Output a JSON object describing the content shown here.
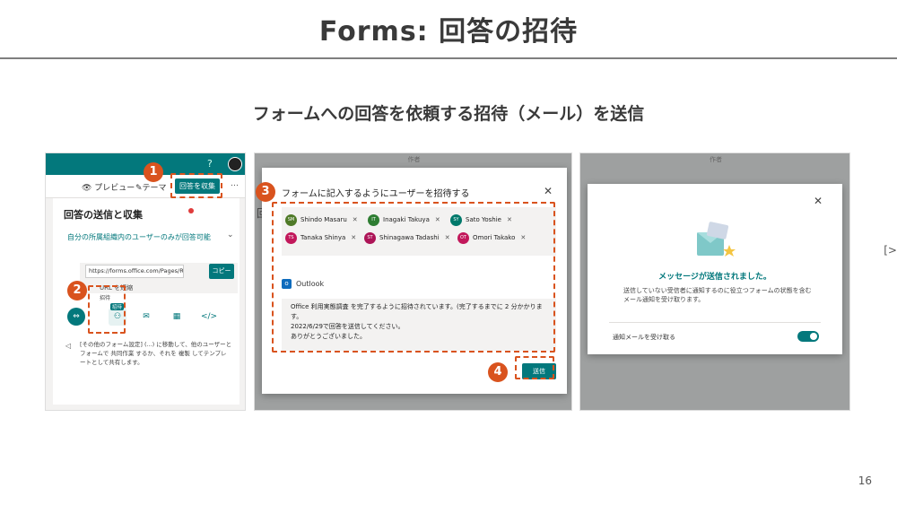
{
  "slide": {
    "title": "Forms: 回答の招待",
    "subtitle": "フォームへの回答を依頼する招待（メール）を送信",
    "page_number": "16",
    "edge_mark": "[>"
  },
  "callouts": [
    "1",
    "2",
    "3",
    "4"
  ],
  "shot1": {
    "help": "?",
    "preview": "👁 プレビュー",
    "theme": "✎テーマ",
    "collect_button": "回答を収集",
    "more": "…",
    "panel_title": "回答の送信と収集",
    "permission": "自分の所属組織内のユーザーのみが回答可能",
    "url": "https://forms.office.com/Pages/Resp...",
    "copy_button": "コピー",
    "short_url": "URL を短縮",
    "icon_label": "招待",
    "invite_badge": "招待",
    "bottom_text": "[その他のフォーム設定] (...) に移動して、他のユーザーとフォームで 共同作業 するか、それを 複製 してテンプレートとして共有します。"
  },
  "shot2": {
    "header": "作者",
    "edge_left": "回",
    "edge_right": "[",
    "title": "フォームに記入するようにユーザーを招待する",
    "close": "✕",
    "people": [
      {
        "initials": "SM",
        "name": "Shindo Masaru",
        "color": "#4f7a28"
      },
      {
        "initials": "IT",
        "name": "Inagaki Takuya",
        "color": "#2e7d32"
      },
      {
        "initials": "SY",
        "name": "Sato Yoshie",
        "color": "#00796b"
      },
      {
        "initials": "TS",
        "name": "Tanaka Shinya",
        "color": "#c2185b"
      },
      {
        "initials": "ST",
        "name": "Shinagawa Tadashi",
        "color": "#ad1457"
      },
      {
        "initials": "OT",
        "name": "Omori Takako",
        "color": "#c2185b"
      }
    ],
    "outlook_label": "Outlook",
    "message_lines": [
      "Office 利用実態調査 を完了するように招待されています。(完了するまでに 2 分かかります。",
      "2022/6/29で回答を送信してください。",
      "ありがとうございました。"
    ],
    "send_button": "送信"
  },
  "shot3": {
    "header": "作者",
    "close": "✕",
    "heading": "メッセージが送信されました。",
    "description": "送信していない受信者に通知するのに役立つフォームの状態を含むメール通知を受け取ります。",
    "toggle_label": "通知メールを受け取る",
    "toggle_on": true
  },
  "colors": {
    "accent": "#03787c",
    "callout": "#d9531e"
  }
}
